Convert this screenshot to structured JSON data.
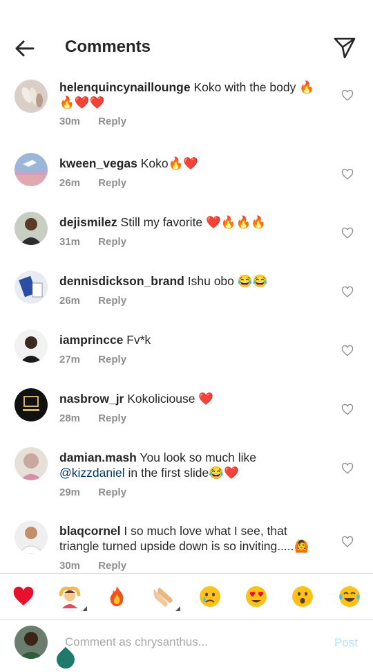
{
  "header": {
    "title": "Comments"
  },
  "comments": [
    {
      "username": "helenquincynaillounge",
      "text": "Koko with the body 🔥",
      "text2": "🔥❤️❤️",
      "time": "30m",
      "reply": "Reply"
    },
    {
      "username": "kween_vegas",
      "text": "Koko🔥❤️",
      "time": "26m",
      "reply": "Reply"
    },
    {
      "username": "dejismilez",
      "text": "Still my favorite ❤️🔥🔥🔥",
      "time": "31m",
      "reply": "Reply"
    },
    {
      "username": "dennisdickson_brand",
      "text": "Ishu obo 😂😂",
      "time": "26m",
      "reply": "Reply"
    },
    {
      "username": "iamprincce",
      "text": "Fv*k",
      "time": "27m",
      "reply": "Reply"
    },
    {
      "username": "nasbrow_jr",
      "text": "Kokoliciouse ❤️",
      "time": "28m",
      "reply": "Reply"
    },
    {
      "username": "damian.mash",
      "text": "You look so much like",
      "mention": "@kizzdaniel",
      "text2": " in the first slide😂❤️",
      "time": "29m",
      "reply": "Reply"
    },
    {
      "username": "blaqcornel",
      "text": "I so much love what I see, that",
      "text2": "triangle turned upside down is so inviting.....🙆",
      "time": "30m",
      "reply": "Reply"
    }
  ],
  "emoji_bar": {
    "items": [
      {
        "name": "red-heart-emoji",
        "glyph": "❤️"
      },
      {
        "name": "person-gesturing-ok-emoji",
        "glyph": "🙆"
      },
      {
        "name": "fire-emoji",
        "glyph": "🔥"
      },
      {
        "name": "clapping-hands-emoji",
        "glyph": "👏"
      },
      {
        "name": "crying-face-emoji",
        "glyph": "😢"
      },
      {
        "name": "heart-eyes-emoji",
        "glyph": "😍"
      },
      {
        "name": "surprised-face-emoji",
        "glyph": "😮"
      },
      {
        "name": "tears-of-joy-emoji",
        "glyph": "😂"
      }
    ]
  },
  "input": {
    "placeholder": "Comment as chrysanthus...",
    "post_label": "Post"
  },
  "colors": {
    "text": "#262626",
    "meta": "#8e8e8e",
    "mention": "#00376b",
    "post_disabled": "#b2dffc",
    "accent_teal": "#1f7a6b"
  }
}
